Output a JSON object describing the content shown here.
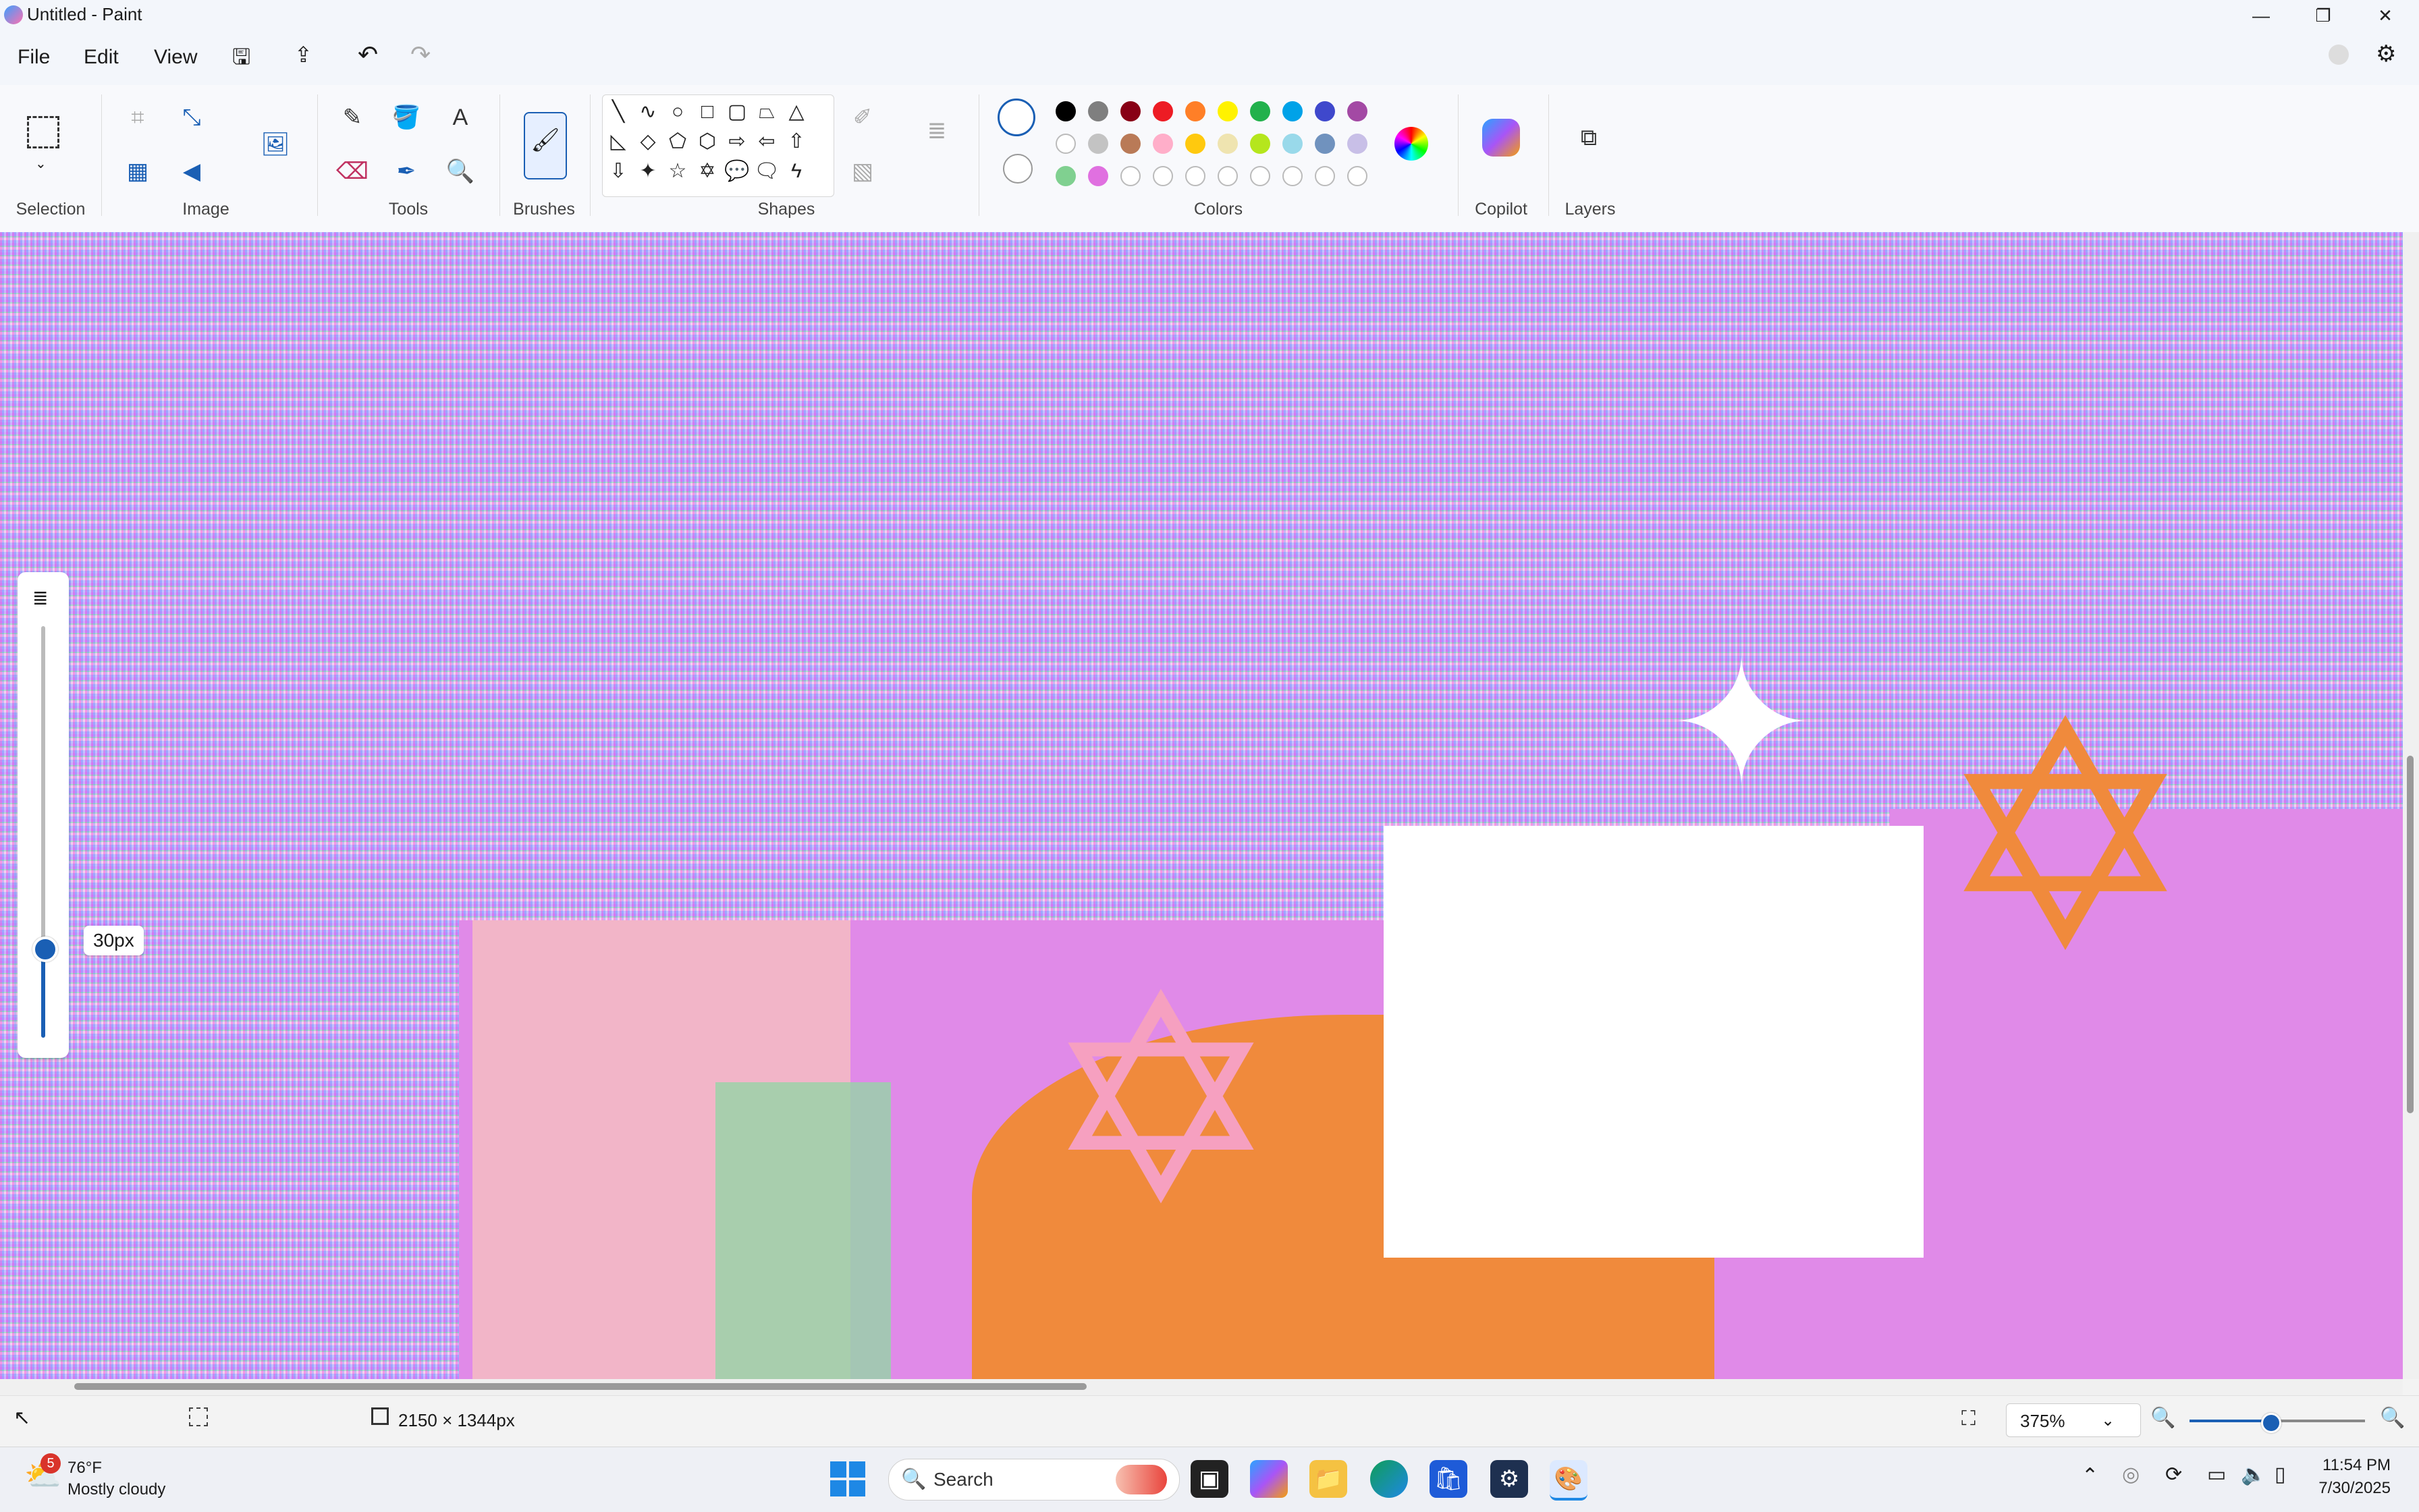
{
  "window": {
    "title": "Untitled - Paint",
    "controls": {
      "minimize": "—",
      "maximize": "❐",
      "close": "✕"
    }
  },
  "menu": {
    "file": "File",
    "edit": "Edit",
    "view": "View"
  },
  "ribbon": {
    "groups": {
      "selection": "Selection",
      "image": "Image",
      "tools": "Tools",
      "brushes": "Brushes",
      "shapes": "Shapes",
      "colors": "Colors",
      "copilot": "Copilot",
      "layers": "Layers"
    },
    "palette_row1": [
      "#000000",
      "#7f7f7f",
      "#880015",
      "#ed1c24",
      "#ff7f27",
      "#fff200",
      "#22b14c",
      "#00a2e8",
      "#3f48cc",
      "#a349a4"
    ],
    "palette_row2": [
      "#ffffff",
      "#c3c3c3",
      "#b97a57",
      "#ffaec9",
      "#ffc90e",
      "#efe4b0",
      "#b5e61d",
      "#99d9ea",
      "#7092be",
      "#c8bfe7"
    ],
    "palette_row3": [
      "#80d090",
      "#e070e0",
      "#ffffff",
      "#ffffff",
      "#ffffff",
      "#ffffff",
      "#ffffff",
      "#ffffff",
      "#ffffff",
      "#ffffff"
    ]
  },
  "brush_size": {
    "label": "30px",
    "level_fraction": 0.22
  },
  "status": {
    "dimensions": "2150 × 1344px",
    "zoom": "375%",
    "zoom_level_fraction": 0.45
  },
  "taskbar": {
    "weather_temp": "76°F",
    "weather_desc": "Mostly cloudy",
    "weather_badge": "5",
    "search_placeholder": "Search",
    "time": "11:54 PM",
    "date": "7/30/2025"
  }
}
